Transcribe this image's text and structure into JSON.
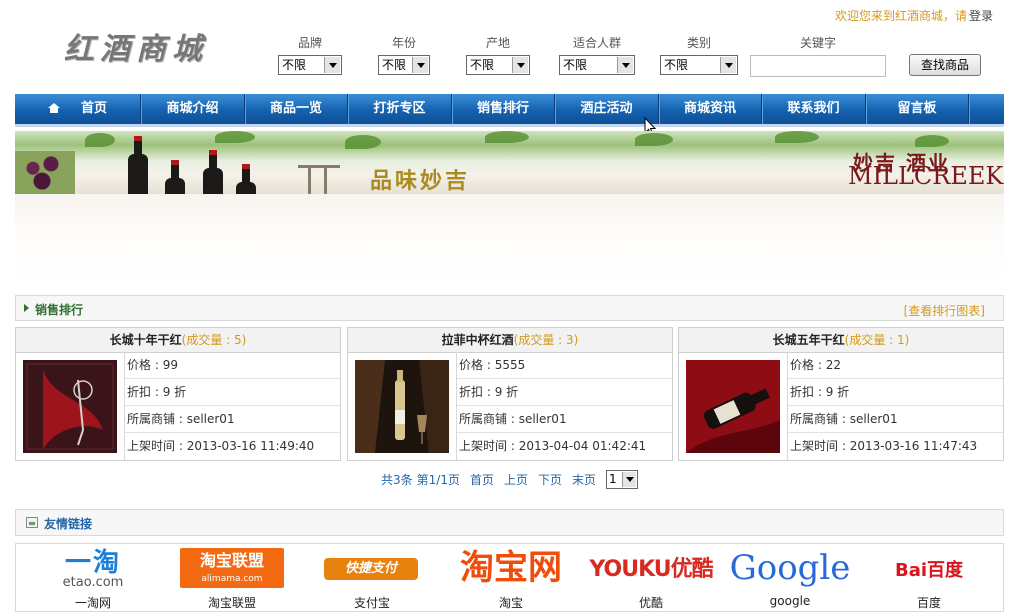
{
  "header": {
    "welcome": "欢迎您来到红酒商城，请",
    "login": "登录",
    "logo_text": "红酒商城"
  },
  "filters": [
    {
      "label": "品牌",
      "value": "不限"
    },
    {
      "label": "年份",
      "value": "不限"
    },
    {
      "label": "产地",
      "value": "不限"
    },
    {
      "label": "适合人群",
      "value": "不限"
    },
    {
      "label": "类别",
      "value": "不限"
    }
  ],
  "search": {
    "label": "关键字",
    "value": "",
    "button": "查找商品"
  },
  "nav": {
    "items": [
      "首页",
      "商城介绍",
      "商品一览",
      "打折专区",
      "销售排行",
      "酒庄活动",
      "商城资讯",
      "联系我们",
      "留言板"
    ]
  },
  "banner": {
    "title": "品味妙吉",
    "brand_cn": "妙吉 酒业",
    "brand_en": "MILLCREEK"
  },
  "ranking": {
    "title": "销售排行",
    "chart_link": "[查看排行图表]",
    "labels": {
      "price": "价格 : ",
      "discount": "折扣 : ",
      "shop": "所属商铺 : ",
      "listed": "上架时间 : "
    },
    "products": [
      {
        "name": "长城十年干红",
        "volume": "(成交量 : 5)",
        "price": "99",
        "discount": "9 折",
        "shop": "seller01",
        "listed": "2013-03-16 11:49:40"
      },
      {
        "name": "拉菲中杯红酒",
        "volume": "(成交量 : 3)",
        "price": "5555",
        "discount": "9 折",
        "shop": "seller01",
        "listed": "2013-04-04 01:42:41"
      },
      {
        "name": "长城五年干红",
        "volume": "(成交量 : 1)",
        "price": "22",
        "discount": "9 折",
        "shop": "seller01",
        "listed": "2013-03-16 11:47:43"
      }
    ]
  },
  "pagination": {
    "total": "共3条",
    "page": "第1/1页",
    "first": "首页",
    "prev": "上页",
    "next": "下页",
    "last": "末页",
    "select": "1"
  },
  "friend_links": {
    "title": "友情链接",
    "items": [
      {
        "logo": "一淘",
        "logo_sub": "etao.com",
        "caption": "一淘网"
      },
      {
        "logo": "淘宝联盟",
        "logo_sub": "alimama.com",
        "caption": "淘宝联盟"
      },
      {
        "logo": "快捷支付",
        "logo_sub": "",
        "caption": "支付宝"
      },
      {
        "logo": "淘宝网",
        "logo_sub": "",
        "caption": "淘宝"
      },
      {
        "logo": "YOUKU优酷",
        "logo_sub": "",
        "caption": "优酷"
      },
      {
        "logo": "Google",
        "logo_sub": "",
        "caption": "google"
      },
      {
        "logo": "Bai百度",
        "logo_sub": "",
        "caption": "百度"
      }
    ]
  }
}
